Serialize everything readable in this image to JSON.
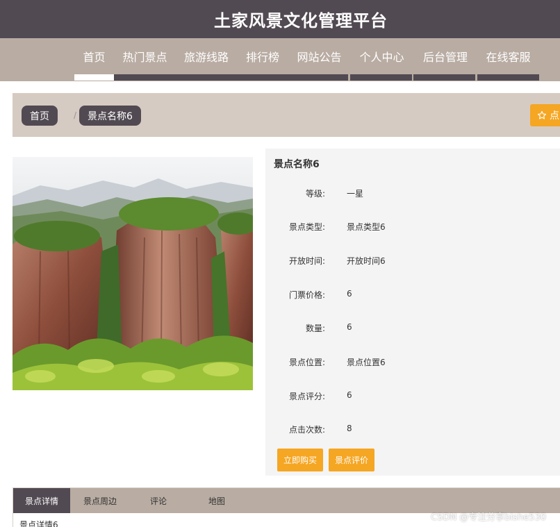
{
  "header": {
    "title": "土家风景文化管理平台"
  },
  "nav": {
    "items": [
      {
        "label": "首页",
        "active": true
      },
      {
        "label": "热门景点",
        "active": false
      },
      {
        "label": "旅游线路",
        "active": false
      },
      {
        "label": "排行榜",
        "active": false
      },
      {
        "label": "网站公告",
        "active": false
      },
      {
        "label": "个人中心",
        "active": false
      },
      {
        "label": "后台管理",
        "active": false
      },
      {
        "label": "在线客服",
        "active": false
      }
    ]
  },
  "breadcrumb": {
    "home": "首页",
    "separator": "/",
    "current": "景点名称6",
    "favorite_label": "点",
    "favorite_icon": "star-outline-icon"
  },
  "detail": {
    "name": "景点名称6",
    "fields": [
      {
        "label": "等级:",
        "value": "一星"
      },
      {
        "label": "景点类型:",
        "value": "景点类型6"
      },
      {
        "label": "开放时间:",
        "value": "开放时间6"
      },
      {
        "label": "门票价格:",
        "value": "6"
      },
      {
        "label": "数量:",
        "value": "6"
      },
      {
        "label": "景点位置:",
        "value": "景点位置6"
      },
      {
        "label": "景点评分:",
        "value": "6"
      },
      {
        "label": "点击次数:",
        "value": "8"
      }
    ],
    "buy_label": "立即购买",
    "review_label": "景点评价"
  },
  "tabs": {
    "items": [
      {
        "label": "景点详情",
        "active": true
      },
      {
        "label": "景点周边",
        "active": false
      },
      {
        "label": "评论",
        "active": false
      },
      {
        "label": "地图",
        "active": false
      }
    ],
    "content": "景点详情6"
  },
  "watermark": "CSDN @专注分享bishe530",
  "colors": {
    "header": "#524a52",
    "nav": "#b9aca3",
    "accent": "#f5a623",
    "panel": "#f4f4f4"
  }
}
